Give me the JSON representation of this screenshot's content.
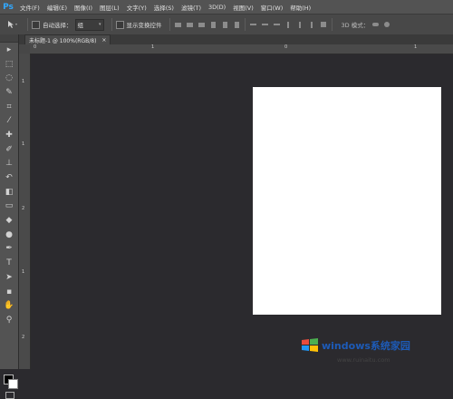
{
  "app": {
    "logo": "Ps"
  },
  "menu": [
    {
      "label": "文件(F)"
    },
    {
      "label": "编辑(E)"
    },
    {
      "label": "图像(I)"
    },
    {
      "label": "图层(L)"
    },
    {
      "label": "文字(Y)"
    },
    {
      "label": "选择(S)"
    },
    {
      "label": "滤镜(T)"
    },
    {
      "label": "3D(D)"
    },
    {
      "label": "视图(V)"
    },
    {
      "label": "窗口(W)"
    },
    {
      "label": "帮助(H)"
    }
  ],
  "options": {
    "auto_select_label": "自动选择：",
    "auto_select_value": "组",
    "show_transform_label": "显示变换控件",
    "mode_3d_label": "3D 模式："
  },
  "document_tab": {
    "title": "未标题-1 @ 100%(RGB/8)",
    "close": "×"
  },
  "rulers": {
    "top": [
      "0",
      "1",
      "0",
      "1"
    ],
    "left": [
      "1",
      "1",
      "2",
      "1",
      "2"
    ]
  },
  "watermark": {
    "brand": "windows系统家园",
    "url": "www.ruinaitu.com"
  },
  "tools": [
    "move-icon",
    "marquee-icon",
    "lasso-icon",
    "quick-select-icon",
    "crop-icon",
    "eyedropper-icon",
    "healing-icon",
    "brush-icon",
    "clone-stamp-icon",
    "history-brush-icon",
    "eraser-icon",
    "gradient-icon",
    "blur-icon",
    "dodge-icon",
    "pen-icon",
    "type-icon",
    "path-select-icon",
    "shape-icon",
    "hand-icon",
    "zoom-icon"
  ],
  "colors": {
    "accent": "#31a8ff",
    "foreground": "#000000",
    "background": "#ffffff"
  }
}
